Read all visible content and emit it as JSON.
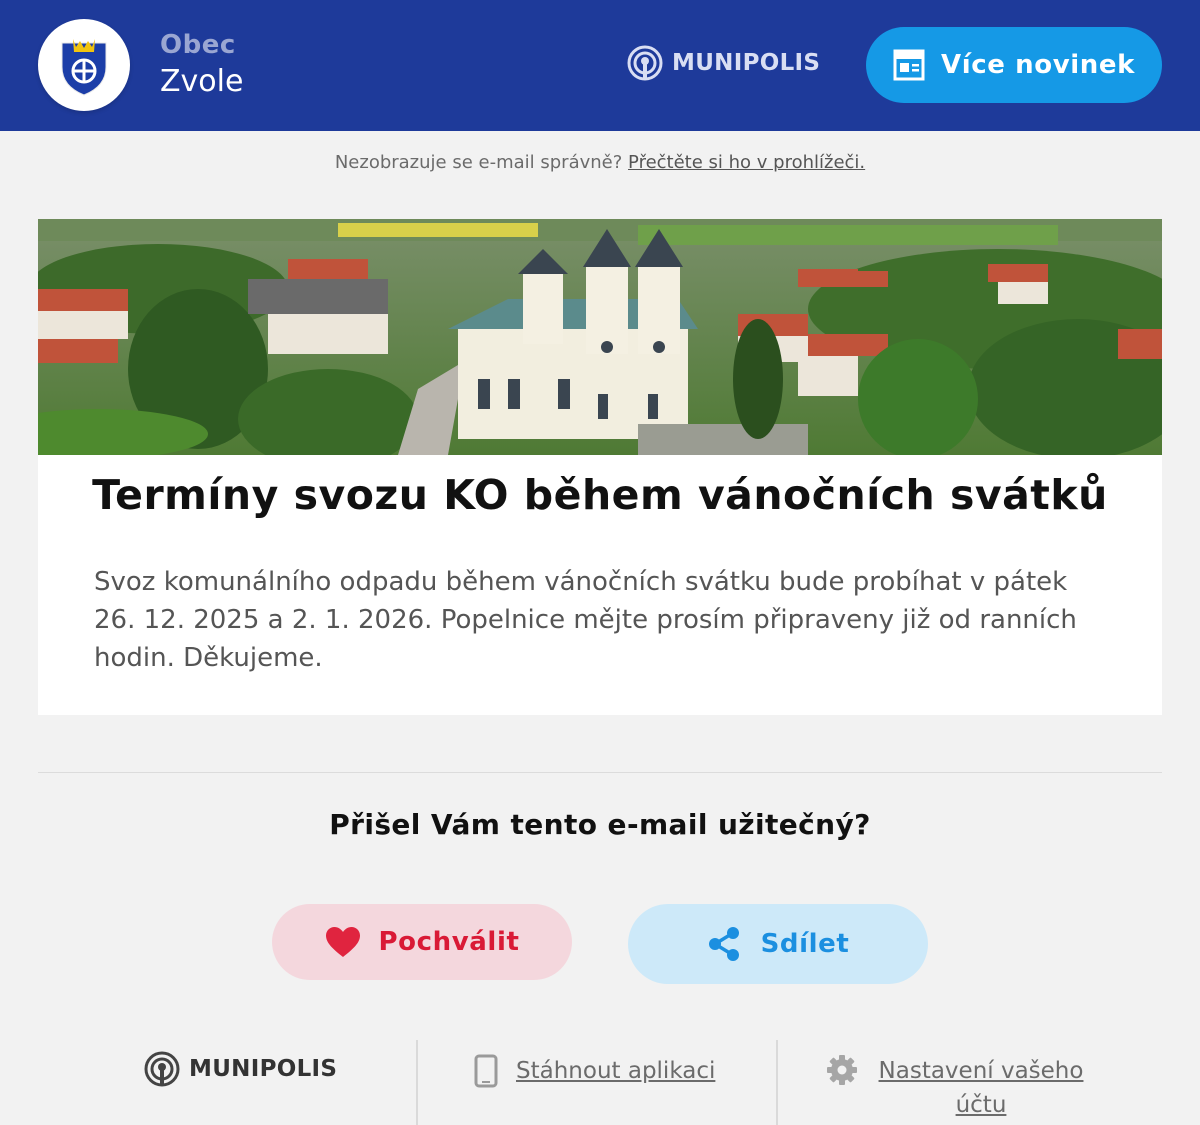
{
  "header": {
    "org_type": "Obec",
    "org_name": "Zvole",
    "brand": "MUNIPOLIS",
    "more_news_label": "Více novinek",
    "more_news_icon": "newspaper-icon",
    "brand_icon": "broadcast-icon",
    "crest_icon": "coat-of-arms-icon"
  },
  "preheader": {
    "text": "Nezobrazuje se e-mail správně?",
    "link": "Přečtěte si ho v prohlížeči."
  },
  "article": {
    "image": "village-church-aerial-photo",
    "title": "Termíny svozu KO během vánočních svátků",
    "body": "Svoz komunálního odpadu během vánočních svátku bude probíhat v pátek  26. 12. 2025 a 2. 1. 2026. Popelnice mějte prosím připraveny již od ranních hodin.  Děkujeme."
  },
  "feedback": {
    "question": "Přišel Vám tento e-mail užitečný?",
    "praise_label": "Pochválit",
    "praise_icon": "heart-icon",
    "share_label": "Sdílet",
    "share_icon": "share-icon"
  },
  "footer": {
    "brand": "MUNIPOLIS",
    "download_label": "Stáhnout aplikaci",
    "download_icon": "smartphone-icon",
    "settings_label": "Nastavení vašeho účtu",
    "settings_icon": "gear-icon"
  },
  "colors": {
    "header_bg": "#1e3a9a",
    "accent_blue": "#1599e6",
    "praise_bg": "#f4d7dd",
    "praise_text": "#d91a36",
    "share_bg": "#cde9f9",
    "share_text": "#1b8fe0",
    "page_bg": "#f2f2f2"
  }
}
